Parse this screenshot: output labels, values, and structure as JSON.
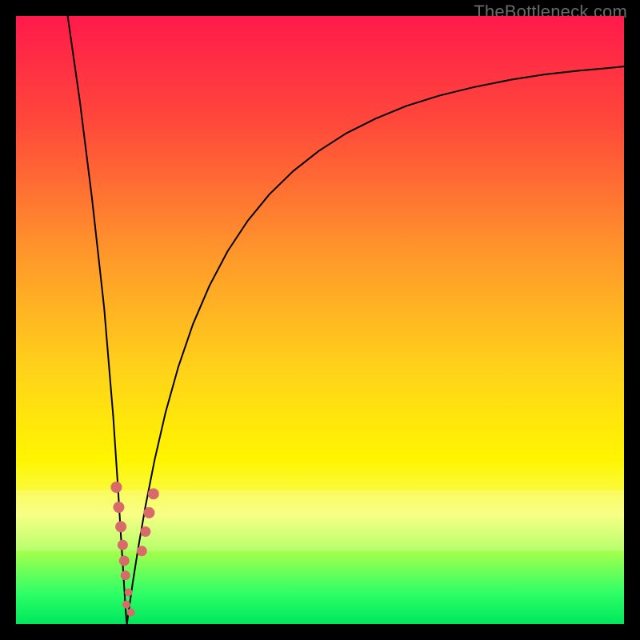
{
  "watermark": "TheBottleneck.com",
  "chart_data": {
    "type": "line",
    "title": "",
    "xlabel": "",
    "ylabel": "",
    "xlim": [
      0,
      100
    ],
    "ylim": [
      0,
      100
    ],
    "grid": false,
    "legend": false,
    "vertical_gradient_stops": [
      {
        "offset": 0.0,
        "color": "#ff1a4b"
      },
      {
        "offset": 0.18,
        "color": "#ff4a3a"
      },
      {
        "offset": 0.4,
        "color": "#ff9a2a"
      },
      {
        "offset": 0.58,
        "color": "#ffd21a"
      },
      {
        "offset": 0.73,
        "color": "#fff500"
      },
      {
        "offset": 0.82,
        "color": "#f6ff6a"
      },
      {
        "offset": 0.88,
        "color": "#a6ff4d"
      },
      {
        "offset": 0.95,
        "color": "#2dff66"
      },
      {
        "offset": 1.0,
        "color": "#00e65c"
      }
    ],
    "series": [
      {
        "name": "left-branch",
        "x": [
          8.5,
          9.5,
          10.5,
          11.5,
          12.5,
          13.5,
          14.5,
          15.0,
          15.5,
          16.0,
          16.4,
          16.8,
          17.1,
          17.35,
          17.55,
          17.7,
          17.85,
          17.95,
          18.03,
          18.1,
          18.15,
          18.2,
          18.25
        ],
        "y": [
          100,
          93,
          86,
          78,
          70,
          61,
          52,
          46,
          40,
          34,
          28,
          22,
          17,
          13,
          10,
          7.5,
          5.3,
          3.6,
          2.4,
          1.4,
          0.7,
          0.25,
          0.05
        ],
        "stroke": "#000000",
        "stroke_width": 2
      },
      {
        "name": "right-branch",
        "x": [
          18.25,
          18.6,
          19.2,
          20.1,
          21.3,
          22.8,
          24.6,
          26.7,
          29.1,
          31.8,
          34.8,
          38.1,
          41.7,
          45.6,
          49.8,
          54.3,
          59.1,
          64.2,
          69.6,
          75.3,
          81.3,
          87.0,
          92.5,
          97.0,
          100.0
        ],
        "y": [
          0.05,
          2.6,
          6.8,
          12.5,
          19.4,
          27.0,
          34.8,
          42.3,
          49.3,
          55.6,
          61.3,
          66.3,
          70.7,
          74.5,
          77.8,
          80.7,
          83.1,
          85.2,
          86.9,
          88.3,
          89.5,
          90.4,
          91.0,
          91.4,
          91.7
        ],
        "stroke": "#000000",
        "stroke_width": 2
      },
      {
        "name": "marker-dots",
        "type": "scatter",
        "points": [
          {
            "x": 16.5,
            "y": 22.5,
            "r": 7
          },
          {
            "x": 16.9,
            "y": 19.2,
            "r": 7
          },
          {
            "x": 17.25,
            "y": 16.0,
            "r": 7
          },
          {
            "x": 17.55,
            "y": 13.0,
            "r": 6.5
          },
          {
            "x": 17.8,
            "y": 10.4,
            "r": 6.5
          },
          {
            "x": 18.0,
            "y": 8.0,
            "r": 6
          },
          {
            "x": 18.5,
            "y": 5.2,
            "r": 5
          },
          {
            "x": 18.15,
            "y": 3.2,
            "r": 5
          },
          {
            "x": 18.9,
            "y": 1.9,
            "r": 5
          },
          {
            "x": 20.7,
            "y": 12.0,
            "r": 6.5
          },
          {
            "x": 21.3,
            "y": 15.2,
            "r": 6.5
          },
          {
            "x": 21.9,
            "y": 18.3,
            "r": 7
          },
          {
            "x": 22.6,
            "y": 21.4,
            "r": 7
          }
        ],
        "fill": "#d96a6a"
      }
    ]
  }
}
